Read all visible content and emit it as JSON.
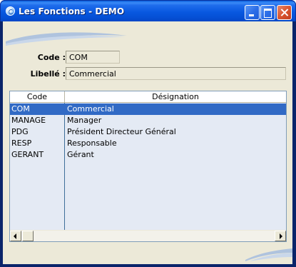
{
  "window": {
    "title": "Les Fonctions - DEMO",
    "title_bar_color": "#0858E0",
    "close_button_color": "#D9552F"
  },
  "form": {
    "code_label": "Code :",
    "code_value": "COM",
    "libelle_label": "Libellé :",
    "libelle_value": "Commercial"
  },
  "table": {
    "columns": [
      "Code",
      "Désignation"
    ],
    "rows": [
      {
        "code": "COM",
        "designation": "Commercial",
        "selected": true
      },
      {
        "code": "MANAGE",
        "designation": "Manager",
        "selected": false
      },
      {
        "code": "PDG",
        "designation": "Président Directeur Général",
        "selected": false
      },
      {
        "code": "RESP",
        "designation": "Responsable",
        "selected": false
      },
      {
        "code": "GERANT",
        "designation": "Gérant",
        "selected": false
      }
    ],
    "selection_color": "#316AC5",
    "background_color": "#E4EAF4"
  },
  "icons": {
    "app": "app-icon",
    "minimize": "minimize-icon",
    "maximize": "maximize-icon",
    "close": "close-icon",
    "scroll_left": "arrow-left-icon",
    "scroll_right": "arrow-right-icon"
  }
}
